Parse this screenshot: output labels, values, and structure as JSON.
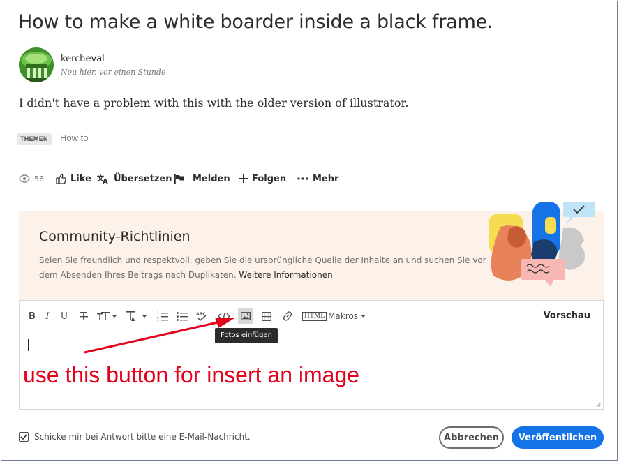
{
  "post": {
    "title": "How to make a white boarder inside a black frame.",
    "author": "kercheval",
    "meta": "Neu hier, vor einen Stunde",
    "body": "I didn't have a problem with this with the older version of illustrator.",
    "tag_label": "THEMEN",
    "tag_value": "How to"
  },
  "actions": {
    "views": "56",
    "like": "Like",
    "translate": "Übersetzen",
    "report": "Melden",
    "follow": "Folgen",
    "more": "Mehr"
  },
  "guidelines": {
    "title": "Community-Richtlinien",
    "text": "Seien Sie freundlich und respektvoll, geben Sie die ursprüngliche Quelle der Inhalte an und suchen Sie vor dem Absenden Ihres Beitrags nach Duplikaten.",
    "link": "Weitere Informationen"
  },
  "editor": {
    "toolbar": {
      "bold": "B",
      "italic": "I",
      "underline": "U",
      "html_badge": "HTML",
      "macros": "Makros",
      "preview": "Vorschau"
    },
    "tooltip": "Fotos einfügen",
    "annotation": "use this button for insert an image"
  },
  "footer": {
    "notify": "Schicke mir bei Antwort bitte eine E-Mail-Nachricht.",
    "notify_checked": true,
    "cancel": "Abbrechen",
    "publish": "Veröffentlichen"
  },
  "colors": {
    "accent": "#1473e6",
    "annotation": "#e2001a",
    "guidelines_bg": "#fdf2ea"
  }
}
